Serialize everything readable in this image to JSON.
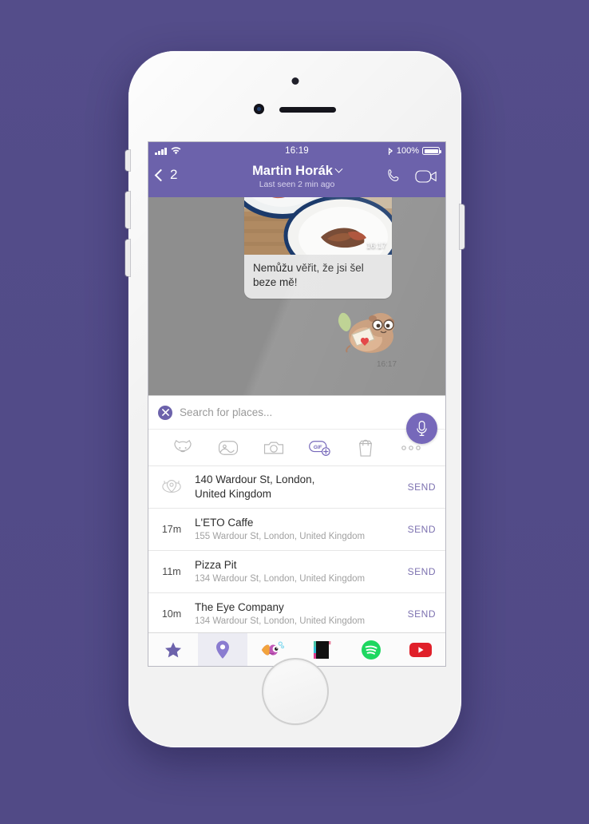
{
  "device": {
    "name": "iphone-white"
  },
  "statusbar": {
    "signal_icon": "cellular-bars-icon",
    "wifi_icon": "wifi-icon",
    "time": "16:19",
    "bluetooth_icon": "bluetooth-icon",
    "battery_percent": "100%",
    "battery_icon": "battery-full-icon"
  },
  "navbar": {
    "back_icon": "chevron-left-icon",
    "back_badge": "2",
    "title": "Martin Horák",
    "title_caret_icon": "chevron-down-icon",
    "subtitle": "Last seen 2 min ago",
    "call_icon": "phone-call-icon",
    "video_icon": "video-call-icon",
    "bg_color": "#6c62ab"
  },
  "chat": {
    "background_color": "#8e8e8e",
    "photo_message": {
      "image_alt": "food-photo",
      "timestamp": "16:17",
      "text": "Nemůžu věřit, že jsi šel beze mě!"
    },
    "sticker_message": {
      "sticker_alt": "otter-love-letter-sticker",
      "timestamp": "16:17"
    }
  },
  "search": {
    "clear_icon": "close-circle-icon",
    "placeholder": "Search for places...",
    "value": "",
    "mic_icon": "microphone-icon",
    "mic_color": "#7668ba"
  },
  "attachments": [
    {
      "name": "sticker-icon",
      "label": "Stickers"
    },
    {
      "name": "photo-icon",
      "label": "Photos"
    },
    {
      "name": "camera-icon",
      "label": "Camera"
    },
    {
      "name": "gif-icon",
      "label": "GIF"
    },
    {
      "name": "shop-icon",
      "label": "Shop"
    },
    {
      "name": "more-icon",
      "label": "More"
    }
  ],
  "places": {
    "send_label": "SEND",
    "items": [
      {
        "lead_icon": "current-location-icon",
        "distance": "",
        "title": "140 Wardour St, London,",
        "title2": "United Kingdom",
        "subtitle": ""
      },
      {
        "lead_icon": "",
        "distance": "17m",
        "title": "L'ETO Caffe",
        "title2": "",
        "subtitle": "155 Wardour St, London,  United Kingdom"
      },
      {
        "lead_icon": "",
        "distance": "11m",
        "title": "Pizza Pit",
        "title2": "",
        "subtitle": "134  Wardour St, London,  United Kingdom"
      },
      {
        "lead_icon": "",
        "distance": "10m",
        "title": "The Eye Company",
        "title2": "",
        "subtitle": "134  Wardour St, London,  United Kingdom"
      }
    ]
  },
  "tabbar": {
    "items": [
      {
        "name": "tab-favorites",
        "icon": "star-icon",
        "active": false
      },
      {
        "name": "tab-location",
        "icon": "location-pin-icon",
        "active": true
      },
      {
        "name": "tab-stickers",
        "icon": "fish-sticker-icon",
        "active": false
      },
      {
        "name": "tab-app-dark",
        "icon": "dark-app-icon",
        "active": false
      },
      {
        "name": "tab-spotify",
        "icon": "spotify-icon",
        "active": false
      },
      {
        "name": "tab-youtube",
        "icon": "youtube-icon",
        "active": false
      }
    ]
  }
}
